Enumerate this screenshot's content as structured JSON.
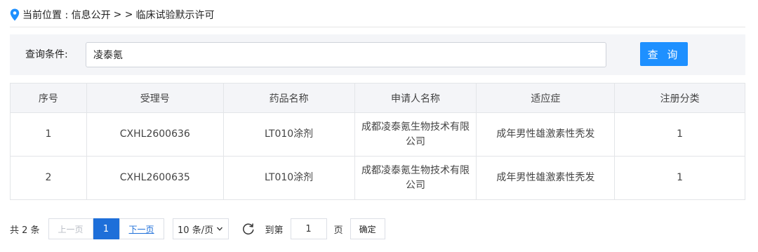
{
  "breadcrumb": {
    "label": "当前位置 : 信息公开",
    "separator": "> >",
    "current": "临床试验默示许可"
  },
  "query": {
    "label": "查询条件:",
    "value": "凌泰氪",
    "button_label": "查 询"
  },
  "table": {
    "headers": [
      "序号",
      "受理号",
      "药品名称",
      "申请人名称",
      "适应症",
      "注册分类"
    ],
    "rows": [
      {
        "index": "1",
        "accept_no": "CXHL2600636",
        "drug": "LT010涂剂",
        "applicant": "成都凌泰氪生物技术有限公司",
        "indication": "成年男性雄激素性秃发",
        "category": "1"
      },
      {
        "index": "2",
        "accept_no": "CXHL2600635",
        "drug": "LT010涂剂",
        "applicant": "成都凌泰氪生物技术有限公司",
        "indication": "成年男性雄激素性秃发",
        "category": "1"
      }
    ]
  },
  "pagination": {
    "total": "共 2 条",
    "prev": "上一页",
    "current": "1",
    "next": "下一页",
    "page_size": "10 条/页",
    "goto_label": "到第",
    "goto_value": "1",
    "page_unit": "页",
    "confirm": "确定"
  },
  "colors": {
    "accent": "#1e90ff",
    "pager_active": "#1e6fd9",
    "panel_bg": "#f4f5f8"
  },
  "icons": [
    "location-pin-icon",
    "chevron-down-icon",
    "refresh-icon"
  ]
}
